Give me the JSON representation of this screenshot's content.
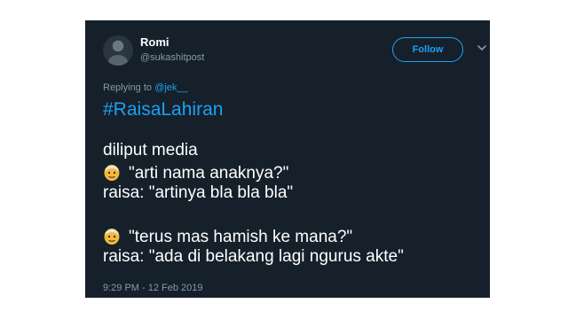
{
  "tweet": {
    "author": {
      "name": "Romi",
      "handle": "@sukashitpost"
    },
    "follow_label": "Follow",
    "reply": {
      "prefix": "Replying to",
      "mention": "@jek__"
    },
    "hashtag": "#RaisaLahiran",
    "lines": [
      "diliput media",
      "\"arti nama anaknya?\"",
      "raisa: \"artinya bla bla bla\"",
      "\"terus mas hamish ke mana?\"",
      "raisa: \"ada di belakang lagi ngurus akte\""
    ],
    "emoji": "older-man-emoji",
    "timestamp": "9:29 PM - 12 Feb 2019"
  },
  "colors": {
    "background": "#15202b",
    "accent": "#1da1f2",
    "muted": "#8899a6",
    "text": "#ffffff"
  }
}
